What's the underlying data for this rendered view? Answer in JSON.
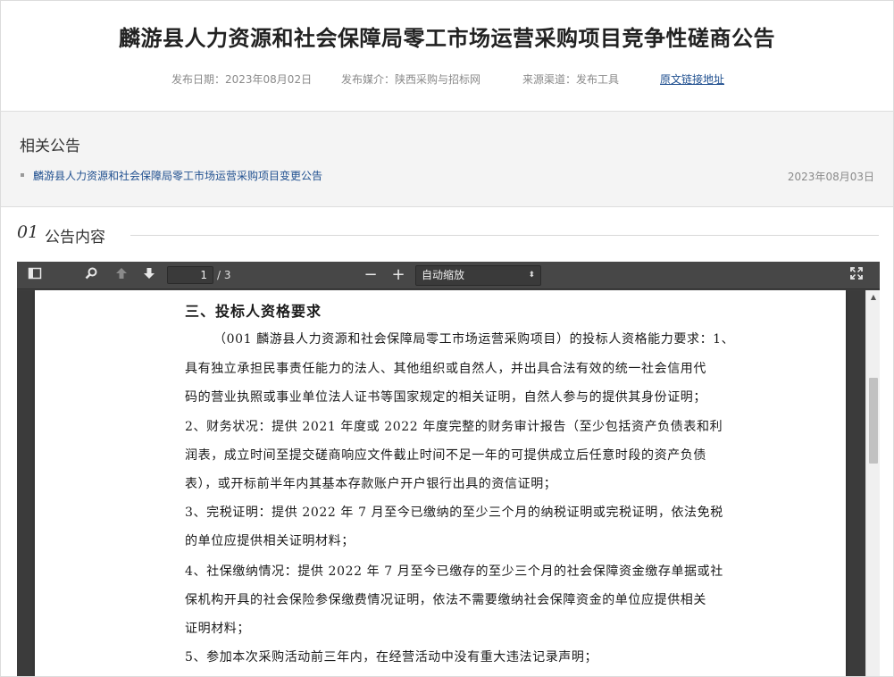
{
  "header": {
    "title": "麟游县人力资源和社会保障局零工市场运营采购项目竞争性磋商公告",
    "publish_date": "发布日期：2023年08月02日",
    "publish_media": "发布媒介：陕西采购与招标网",
    "source": "来源渠道：发布工具",
    "original_link": "原文链接地址"
  },
  "related": {
    "title": "相关公告",
    "items": [
      {
        "label": "麟游县人力资源和社会保障局零工市场运营采购项目变更公告",
        "date": "2023年08月03日"
      }
    ]
  },
  "section": {
    "number": "01",
    "label": "公告内容"
  },
  "viewer": {
    "toolbar": {
      "sidebar_icon": "sidebar-toggle-icon",
      "search_icon": "search-icon",
      "prev_icon": "arrow-up-icon",
      "next_icon": "arrow-down-icon",
      "page_current": "1",
      "page_total": "/ 3",
      "zoom_out": "−",
      "zoom_in": "+",
      "zoom_value": "自动缩放",
      "fullscreen_icon": "fullscreen-icon"
    },
    "document_lines": [
      "三、投标人资格要求",
      "（001 麟游县人力资源和社会保障局零工市场运营采购项目）的投标人资格能力要求：1、",
      "具有独立承担民事责任能力的法人、其他组织或自然人，并出具合法有效的统一社会信用代",
      "码的营业执照或事业单位法人证书等国家规定的相关证明，自然人参与的提供其身份证明；",
      "2、财务状况：提供 2021 年度或 2022 年度完整的财务审计报告（至少包括资产负债表和利",
      "润表，成立时间至提交磋商响应文件截止时间不足一年的可提供成立后任意时段的资产负债",
      "表），或开标前半年内其基本存款账户开户银行出具的资信证明；",
      "3、完税证明：提供 2022 年 7 月至今已缴纳的至少三个月的纳税证明或完税证明，依法免税",
      "的单位应提供相关证明材料；",
      "4、社保缴纳情况：提供 2022 年 7 月至今已缴存的至少三个月的社会保障资金缴存单据或社",
      "保机构开具的社会保险参保缴费情况证明，依法不需要缴纳社会保障资金的单位应提供相关",
      "证明材料；",
      "5、参加本次采购活动前三年内，在经营活动中没有重大违法记录声明；"
    ]
  }
}
